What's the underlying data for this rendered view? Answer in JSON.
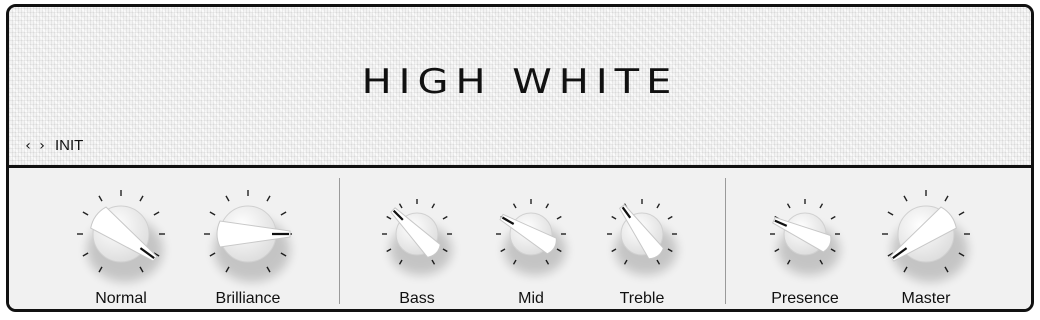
{
  "header": {
    "title": "HIGH WHITE",
    "preset": {
      "prev_icon": "chevron-left-icon",
      "next_icon": "chevron-right-icon",
      "name": "INIT"
    }
  },
  "knobs": [
    {
      "label": "Normal",
      "value": 0.92,
      "size": "large"
    },
    {
      "label": "Brilliance",
      "value": 0.8,
      "size": "large"
    },
    {
      "label": "Bass",
      "value": 0.35,
      "size": "small"
    },
    {
      "label": "Mid",
      "value": 0.3,
      "size": "small"
    },
    {
      "label": "Treble",
      "value": 0.38,
      "size": "small"
    },
    {
      "label": "Presence",
      "value": 0.28,
      "size": "small"
    },
    {
      "label": "Master",
      "value": 0.08,
      "size": "large"
    }
  ],
  "colors": {
    "frame": "#111111",
    "panel": "#f1f1f1",
    "tolex": "#f3f3f3",
    "knob": "#ffffff"
  }
}
